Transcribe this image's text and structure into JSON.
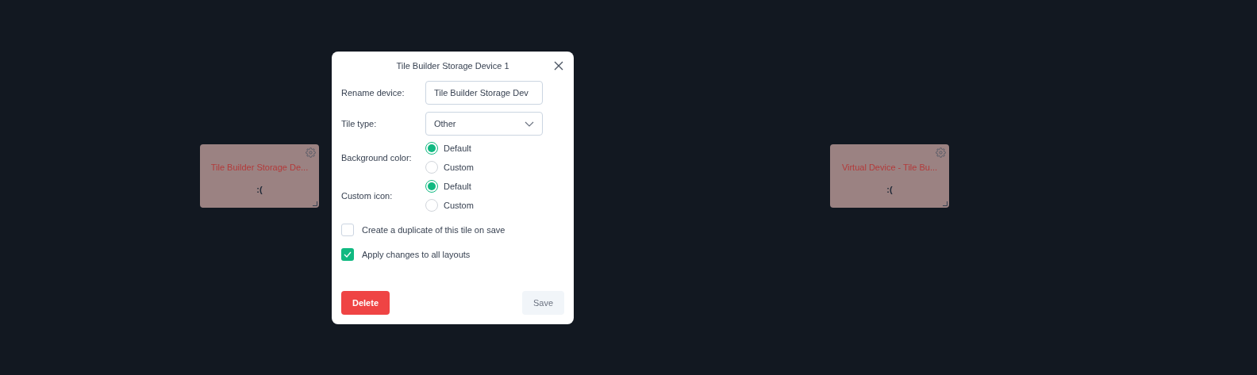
{
  "tiles": [
    {
      "label": "Tile Builder Storage De...",
      "status": ":("
    },
    {
      "label": "Virtual Device - Tile Bu...",
      "status": ":("
    }
  ],
  "dialog": {
    "title": "Tile Builder Storage Device 1",
    "rename": {
      "label": "Rename device:",
      "value": "Tile Builder Storage Dev"
    },
    "tile_type": {
      "label": "Tile type:",
      "value": "Other"
    },
    "radio_groups": [
      {
        "label": "Background color:",
        "options": [
          {
            "label": "Default",
            "selected": true
          },
          {
            "label": "Custom",
            "selected": false
          }
        ]
      },
      {
        "label": "Custom icon:",
        "options": [
          {
            "label": "Default",
            "selected": true
          },
          {
            "label": "Custom",
            "selected": false
          }
        ]
      }
    ],
    "checkboxes": [
      {
        "label": "Create a duplicate of this tile on save",
        "checked": false
      },
      {
        "label": "Apply changes to all layouts",
        "checked": true
      }
    ],
    "delete_button": "Delete",
    "save_button": "Save"
  }
}
